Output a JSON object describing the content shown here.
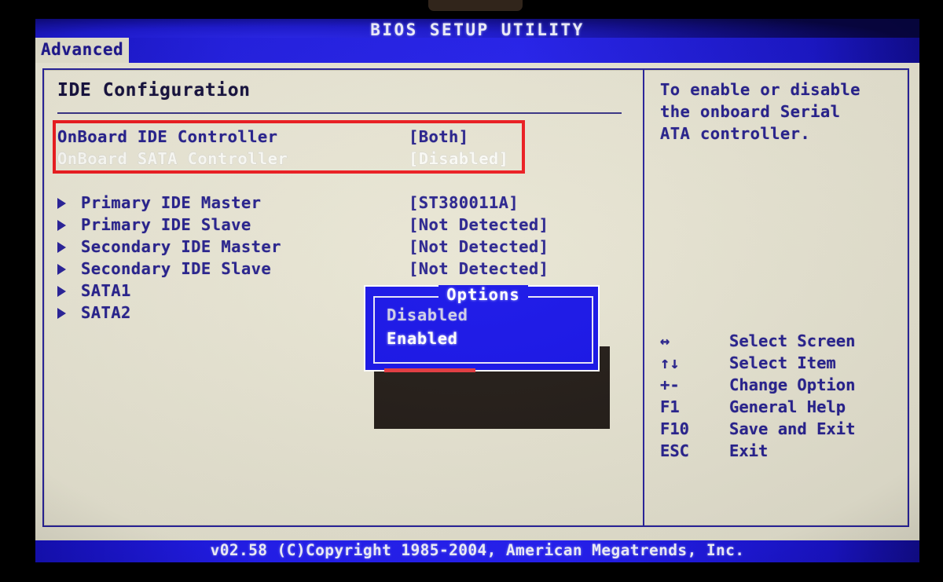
{
  "window": {
    "title": "BIOS SETUP UTILITY",
    "footer": "v02.58 (C)Copyright 1985-2004, American Megatrends, Inc."
  },
  "tabs": [
    {
      "label": "Advanced",
      "active": true
    }
  ],
  "main": {
    "section_title": "IDE Configuration",
    "settings": [
      {
        "label": "OnBoard IDE Controller",
        "value": "[Both]",
        "bullet": false,
        "selected": false
      },
      {
        "label": "OnBoard SATA Controller",
        "value": "[Disabled]",
        "bullet": false,
        "selected": true
      },
      {
        "label": "Primary IDE Master",
        "value": "[ST380011A]",
        "bullet": true,
        "selected": false
      },
      {
        "label": "Primary IDE Slave",
        "value": "[Not Detected]",
        "bullet": true,
        "selected": false
      },
      {
        "label": "Secondary IDE Master",
        "value": "[Not Detected]",
        "bullet": true,
        "selected": false
      },
      {
        "label": "Secondary IDE Slave",
        "value": "[Not Detected]",
        "bullet": true,
        "selected": false
      },
      {
        "label": "SATA1",
        "value": "",
        "bullet": true,
        "selected": false
      },
      {
        "label": "SATA2",
        "value": "",
        "bullet": true,
        "selected": false
      }
    ]
  },
  "options_dialog": {
    "title": "Options",
    "items": [
      {
        "label": "Disabled",
        "highlighted": false
      },
      {
        "label": "Enabled",
        "highlighted": true
      }
    ]
  },
  "help": {
    "text_lines": [
      "To enable or disable",
      "the onboard Serial",
      "ATA controller."
    ],
    "keys": [
      {
        "key": "↔",
        "desc": "Select Screen"
      },
      {
        "key": "↑↓",
        "desc": "Select Item"
      },
      {
        "key": "+-",
        "desc": "Change Option"
      },
      {
        "key": "F1",
        "desc": "General Help"
      },
      {
        "key": "F10",
        "desc": "Save and Exit"
      },
      {
        "key": "ESC",
        "desc": "Exit"
      }
    ]
  },
  "annotations": {
    "highlight_box_color": "#ee1c20",
    "underline_color": "#e33a3f"
  },
  "colors": {
    "screen_blue": "#1d1bbd",
    "panel_beige": "#e9e6d4",
    "text_blue": "#27218e",
    "dialog_blue": "#1713e8"
  }
}
